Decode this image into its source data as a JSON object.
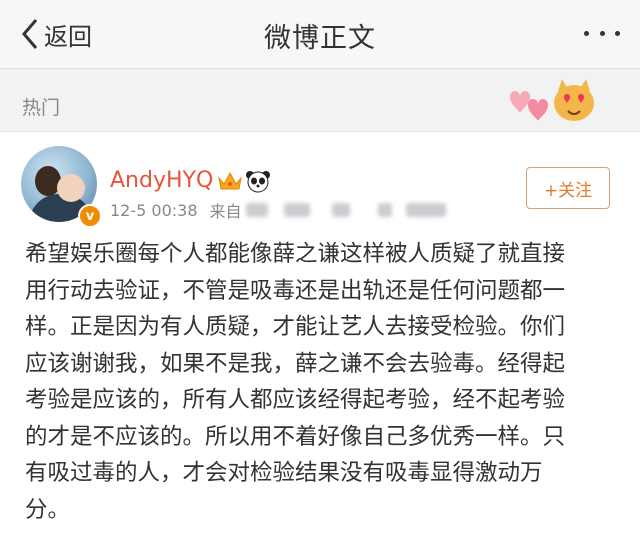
{
  "nav": {
    "back_label": "返回",
    "title": "微博正文"
  },
  "tag": {
    "label": "热门"
  },
  "post": {
    "author": "AndyHYQ",
    "verified_badge": "v",
    "timestamp": "12-5 00:38",
    "source_prefix": "来自",
    "follow_label": "+关注",
    "lines": [
      "希望娱乐圈每个人都能像薛之谦这样被人质疑了就直接",
      "用行动去验证，不管是吸毒还是出轨还是任何问题都一",
      "样。正是因为有人质疑，才能让艺人去接受检验。你们",
      "应该谢谢我，如果不是我，薛之谦不会去验毒。经得起",
      "考验是应该的，所有人都应该经得起考验，经不起考验",
      "的才是不应该的。所以用不着好像自己多优秀一样。只",
      "有吸过毒的人，才会对检验结果没有吸毒显得激动万",
      "分。"
    ]
  },
  "icons": {
    "back": "chevron-left-icon",
    "more": "more-dots-icon",
    "crown": "crown-icon",
    "panda": "panda-icon",
    "sticker": "cat-hearts-sticker"
  },
  "colors": {
    "nav_bg": "#f7f7f7",
    "tag_bg": "#f2f2f2",
    "username": "#e8543c",
    "follow": "#e07b2a",
    "text": "#333333",
    "meta": "#888888"
  }
}
